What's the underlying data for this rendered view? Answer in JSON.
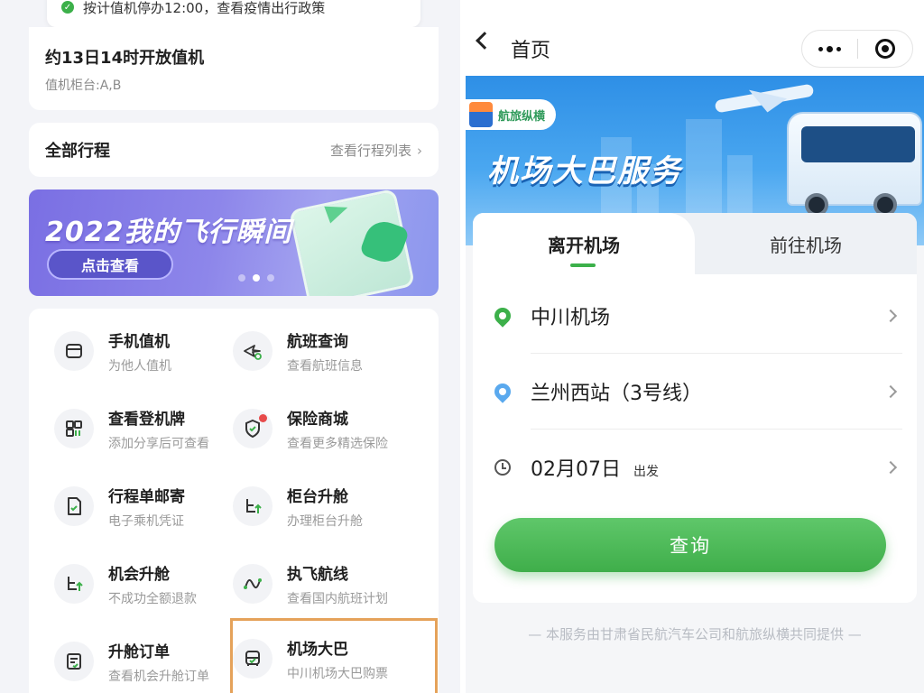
{
  "left": {
    "notice_text": "按计值机停办12:00，查看疫情出行政策",
    "checkin": {
      "title": "约13日14时开放值机",
      "counter": "值机柜台:A,B"
    },
    "trips": {
      "title": "全部行程",
      "link": "查看行程列表"
    },
    "banner": {
      "title": "2022我的飞行瞬间",
      "cta": "点击查看",
      "dots_total": 3,
      "active_dot": 2
    },
    "services": [
      {
        "title": "手机值机",
        "sub": "为他人值机",
        "icon": "tablet-icon"
      },
      {
        "title": "航班查询",
        "sub": "查看航班信息",
        "icon": "plane-search-icon"
      },
      {
        "title": "查看登机牌",
        "sub": "添加分享后可查看",
        "icon": "grid-card-icon"
      },
      {
        "title": "保险商城",
        "sub": "查看更多精选保险",
        "icon": "shield-check-icon"
      },
      {
        "title": "行程单邮寄",
        "sub": "电子乘机凭证",
        "icon": "document-check-icon"
      },
      {
        "title": "柜台升舱",
        "sub": "办理柜台升舱",
        "icon": "seat-up-icon"
      },
      {
        "title": "机会升舱",
        "sub": "不成功全额退款",
        "icon": "seat-up-icon"
      },
      {
        "title": "执飞航线",
        "sub": "查看国内航班计划",
        "icon": "route-icon"
      },
      {
        "title": "升舱订单",
        "sub": "查看机会升舱订单",
        "icon": "order-list-icon"
      },
      {
        "title": "机场大巴",
        "sub": "中川机场大巴购票",
        "icon": "bus-ticket-icon"
      }
    ]
  },
  "right": {
    "nav_title": "首页",
    "hero": {
      "badge": "航旅纵横",
      "title": "机场大巴服务"
    },
    "tabs": [
      {
        "label": "离开机场",
        "active": true
      },
      {
        "label": "前往机场",
        "active": false
      }
    ],
    "from": "中川机场",
    "to": "兰州西站（3号线）",
    "date": "02月07日",
    "date_suffix": "出发",
    "search_label": "查询",
    "footer": "— 本服务由甘肃省民航汽车公司和航旅纵横共同提供 —"
  },
  "colors": {
    "accent_green": "#3cb04a",
    "highlight_orange": "#e5a25a",
    "hero_blue": "#2e8fe6",
    "banner_purple": "#7a6fe3"
  }
}
